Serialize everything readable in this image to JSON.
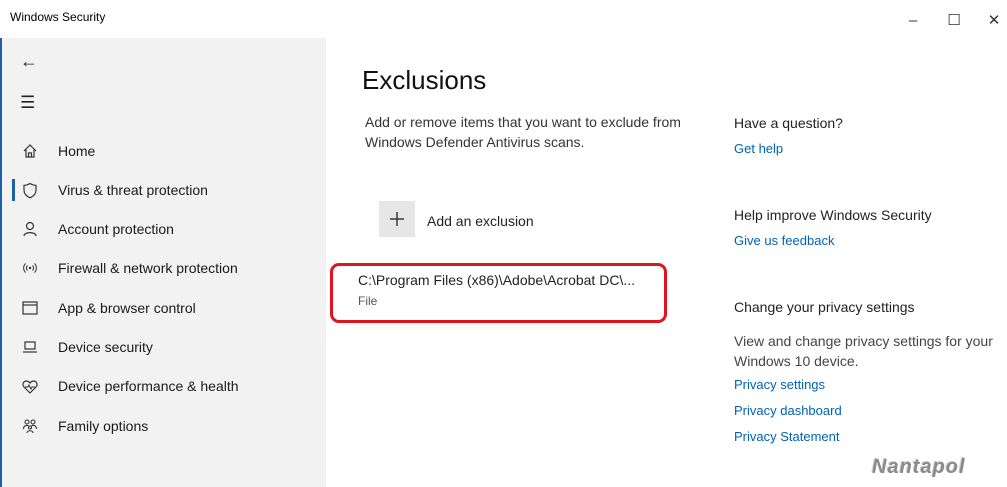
{
  "window": {
    "title": "Windows Security",
    "minimize_glyph": "–",
    "maximize_glyph": "☐",
    "close_glyph": "✕"
  },
  "sidebar": {
    "back_icon": "back-arrow-icon",
    "menu_icon": "hamburger-menu-icon",
    "items": [
      {
        "label": "Home",
        "icon": "home-icon",
        "selected": false
      },
      {
        "label": "Virus & threat protection",
        "icon": "shield-icon",
        "selected": true
      },
      {
        "label": "Account protection",
        "icon": "person-icon",
        "selected": false
      },
      {
        "label": "Firewall & network protection",
        "icon": "wireless-icon",
        "selected": false
      },
      {
        "label": "App & browser control",
        "icon": "browser-window-icon",
        "selected": false
      },
      {
        "label": "Device security",
        "icon": "laptop-icon",
        "selected": false
      },
      {
        "label": "Device performance & health",
        "icon": "heart-icon",
        "selected": false
      },
      {
        "label": "Family options",
        "icon": "family-icon",
        "selected": false
      }
    ]
  },
  "main": {
    "title": "Exclusions",
    "description": "Add or remove items that you want to exclude from Windows Defender Antivirus scans.",
    "add_button_label": "Add an exclusion",
    "exclusions": [
      {
        "path": "C:\\Program Files (x86)\\Adobe\\Acrobat DC\\...",
        "type": "File"
      }
    ]
  },
  "right_panel": {
    "question_heading": "Have a question?",
    "get_help_link": "Get help",
    "improve_heading": "Help improve Windows Security",
    "feedback_link": "Give us feedback",
    "privacy_heading": "Change your privacy settings",
    "privacy_text": "View and change privacy settings for your Windows 10 device.",
    "privacy_links": [
      "Privacy settings",
      "Privacy dashboard",
      "Privacy Statement"
    ]
  },
  "watermark": "Nantapol",
  "colors": {
    "accent": "#1d5fa8",
    "link": "#0063b1",
    "highlight": "#e0141d",
    "sidebar_bg": "#f2f2f2"
  }
}
